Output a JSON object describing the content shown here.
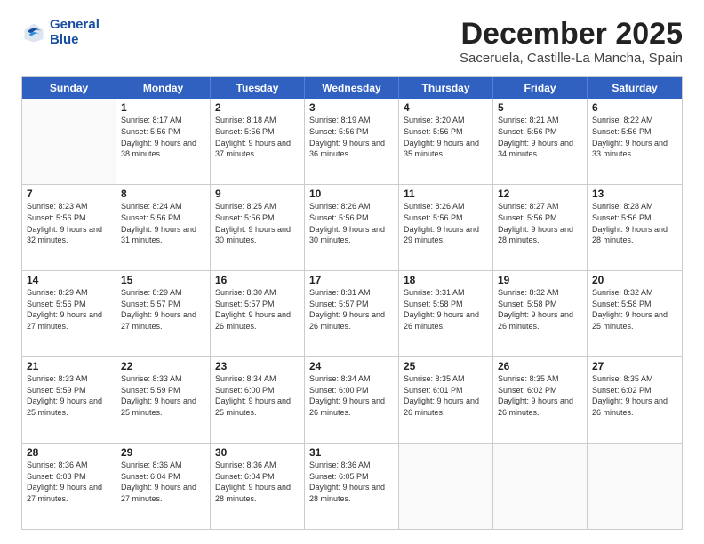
{
  "logo": {
    "line1": "General",
    "line2": "Blue"
  },
  "title": "December 2025",
  "subtitle": "Saceruela, Castille-La Mancha, Spain",
  "header_days": [
    "Sunday",
    "Monday",
    "Tuesday",
    "Wednesday",
    "Thursday",
    "Friday",
    "Saturday"
  ],
  "weeks": [
    [
      {
        "day": "",
        "sunrise": "",
        "sunset": "",
        "daylight": "",
        "empty": true
      },
      {
        "day": "1",
        "sunrise": "Sunrise: 8:17 AM",
        "sunset": "Sunset: 5:56 PM",
        "daylight": "Daylight: 9 hours and 38 minutes."
      },
      {
        "day": "2",
        "sunrise": "Sunrise: 8:18 AM",
        "sunset": "Sunset: 5:56 PM",
        "daylight": "Daylight: 9 hours and 37 minutes."
      },
      {
        "day": "3",
        "sunrise": "Sunrise: 8:19 AM",
        "sunset": "Sunset: 5:56 PM",
        "daylight": "Daylight: 9 hours and 36 minutes."
      },
      {
        "day": "4",
        "sunrise": "Sunrise: 8:20 AM",
        "sunset": "Sunset: 5:56 PM",
        "daylight": "Daylight: 9 hours and 35 minutes."
      },
      {
        "day": "5",
        "sunrise": "Sunrise: 8:21 AM",
        "sunset": "Sunset: 5:56 PM",
        "daylight": "Daylight: 9 hours and 34 minutes."
      },
      {
        "day": "6",
        "sunrise": "Sunrise: 8:22 AM",
        "sunset": "Sunset: 5:56 PM",
        "daylight": "Daylight: 9 hours and 33 minutes."
      }
    ],
    [
      {
        "day": "7",
        "sunrise": "Sunrise: 8:23 AM",
        "sunset": "Sunset: 5:56 PM",
        "daylight": "Daylight: 9 hours and 32 minutes."
      },
      {
        "day": "8",
        "sunrise": "Sunrise: 8:24 AM",
        "sunset": "Sunset: 5:56 PM",
        "daylight": "Daylight: 9 hours and 31 minutes."
      },
      {
        "day": "9",
        "sunrise": "Sunrise: 8:25 AM",
        "sunset": "Sunset: 5:56 PM",
        "daylight": "Daylight: 9 hours and 30 minutes."
      },
      {
        "day": "10",
        "sunrise": "Sunrise: 8:26 AM",
        "sunset": "Sunset: 5:56 PM",
        "daylight": "Daylight: 9 hours and 30 minutes."
      },
      {
        "day": "11",
        "sunrise": "Sunrise: 8:26 AM",
        "sunset": "Sunset: 5:56 PM",
        "daylight": "Daylight: 9 hours and 29 minutes."
      },
      {
        "day": "12",
        "sunrise": "Sunrise: 8:27 AM",
        "sunset": "Sunset: 5:56 PM",
        "daylight": "Daylight: 9 hours and 28 minutes."
      },
      {
        "day": "13",
        "sunrise": "Sunrise: 8:28 AM",
        "sunset": "Sunset: 5:56 PM",
        "daylight": "Daylight: 9 hours and 28 minutes."
      }
    ],
    [
      {
        "day": "14",
        "sunrise": "Sunrise: 8:29 AM",
        "sunset": "Sunset: 5:56 PM",
        "daylight": "Daylight: 9 hours and 27 minutes."
      },
      {
        "day": "15",
        "sunrise": "Sunrise: 8:29 AM",
        "sunset": "Sunset: 5:57 PM",
        "daylight": "Daylight: 9 hours and 27 minutes."
      },
      {
        "day": "16",
        "sunrise": "Sunrise: 8:30 AM",
        "sunset": "Sunset: 5:57 PM",
        "daylight": "Daylight: 9 hours and 26 minutes."
      },
      {
        "day": "17",
        "sunrise": "Sunrise: 8:31 AM",
        "sunset": "Sunset: 5:57 PM",
        "daylight": "Daylight: 9 hours and 26 minutes."
      },
      {
        "day": "18",
        "sunrise": "Sunrise: 8:31 AM",
        "sunset": "Sunset: 5:58 PM",
        "daylight": "Daylight: 9 hours and 26 minutes."
      },
      {
        "day": "19",
        "sunrise": "Sunrise: 8:32 AM",
        "sunset": "Sunset: 5:58 PM",
        "daylight": "Daylight: 9 hours and 26 minutes."
      },
      {
        "day": "20",
        "sunrise": "Sunrise: 8:32 AM",
        "sunset": "Sunset: 5:58 PM",
        "daylight": "Daylight: 9 hours and 25 minutes."
      }
    ],
    [
      {
        "day": "21",
        "sunrise": "Sunrise: 8:33 AM",
        "sunset": "Sunset: 5:59 PM",
        "daylight": "Daylight: 9 hours and 25 minutes."
      },
      {
        "day": "22",
        "sunrise": "Sunrise: 8:33 AM",
        "sunset": "Sunset: 5:59 PM",
        "daylight": "Daylight: 9 hours and 25 minutes."
      },
      {
        "day": "23",
        "sunrise": "Sunrise: 8:34 AM",
        "sunset": "Sunset: 6:00 PM",
        "daylight": "Daylight: 9 hours and 25 minutes."
      },
      {
        "day": "24",
        "sunrise": "Sunrise: 8:34 AM",
        "sunset": "Sunset: 6:00 PM",
        "daylight": "Daylight: 9 hours and 26 minutes."
      },
      {
        "day": "25",
        "sunrise": "Sunrise: 8:35 AM",
        "sunset": "Sunset: 6:01 PM",
        "daylight": "Daylight: 9 hours and 26 minutes."
      },
      {
        "day": "26",
        "sunrise": "Sunrise: 8:35 AM",
        "sunset": "Sunset: 6:02 PM",
        "daylight": "Daylight: 9 hours and 26 minutes."
      },
      {
        "day": "27",
        "sunrise": "Sunrise: 8:35 AM",
        "sunset": "Sunset: 6:02 PM",
        "daylight": "Daylight: 9 hours and 26 minutes."
      }
    ],
    [
      {
        "day": "28",
        "sunrise": "Sunrise: 8:36 AM",
        "sunset": "Sunset: 6:03 PM",
        "daylight": "Daylight: 9 hours and 27 minutes."
      },
      {
        "day": "29",
        "sunrise": "Sunrise: 8:36 AM",
        "sunset": "Sunset: 6:04 PM",
        "daylight": "Daylight: 9 hours and 27 minutes."
      },
      {
        "day": "30",
        "sunrise": "Sunrise: 8:36 AM",
        "sunset": "Sunset: 6:04 PM",
        "daylight": "Daylight: 9 hours and 28 minutes."
      },
      {
        "day": "31",
        "sunrise": "Sunrise: 8:36 AM",
        "sunset": "Sunset: 6:05 PM",
        "daylight": "Daylight: 9 hours and 28 minutes."
      },
      {
        "day": "",
        "sunrise": "",
        "sunset": "",
        "daylight": "",
        "empty": true
      },
      {
        "day": "",
        "sunrise": "",
        "sunset": "",
        "daylight": "",
        "empty": true
      },
      {
        "day": "",
        "sunrise": "",
        "sunset": "",
        "daylight": "",
        "empty": true
      }
    ]
  ]
}
